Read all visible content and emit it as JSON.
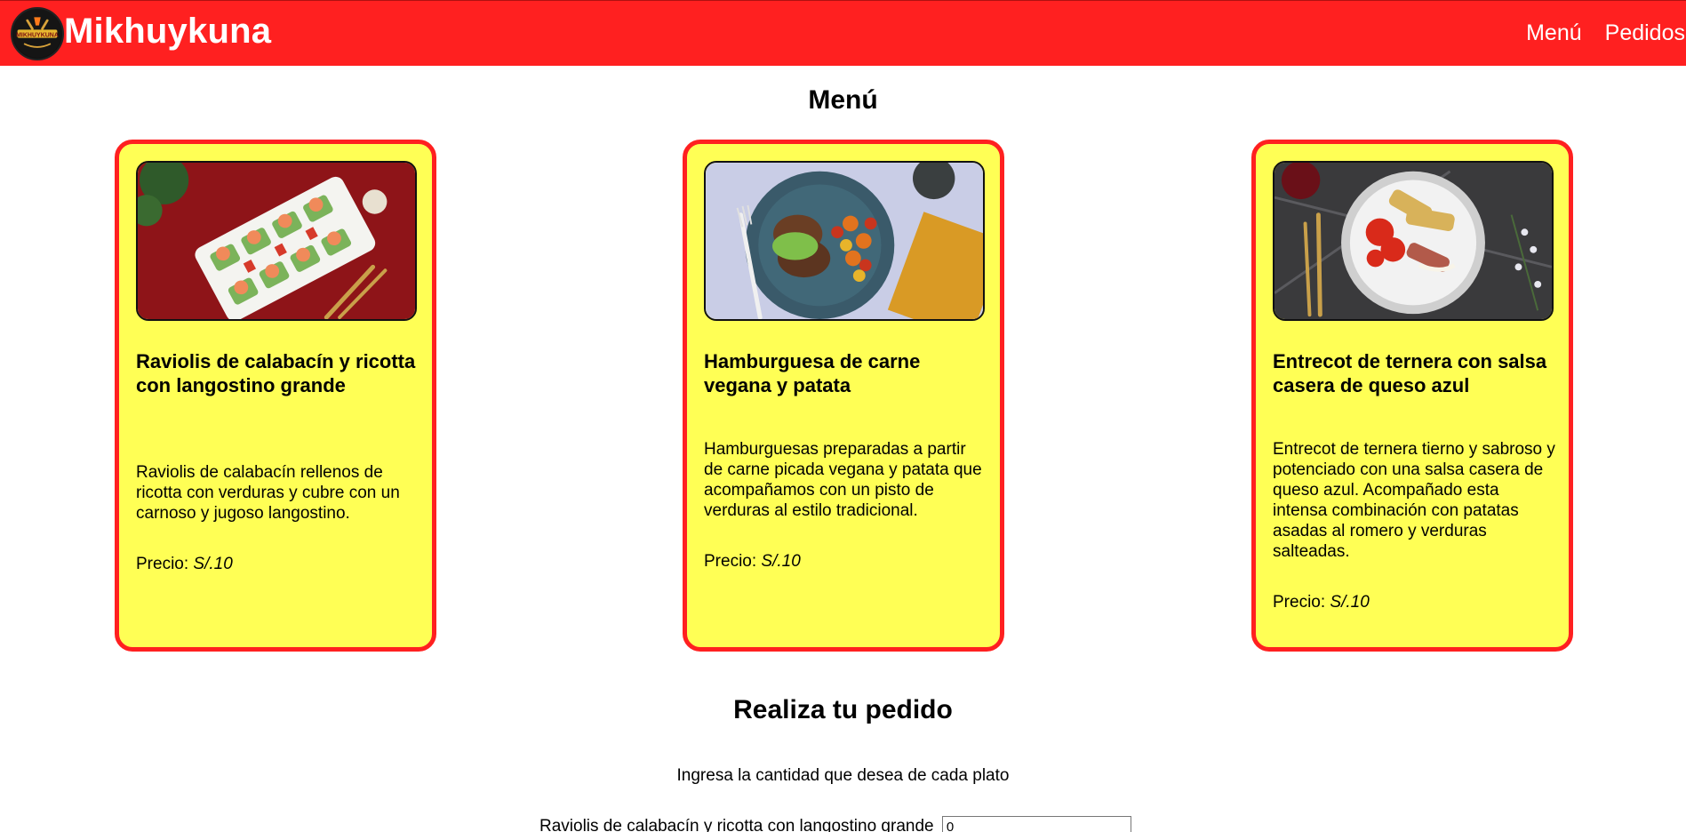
{
  "header": {
    "logo_text": "MIKHUYKUNA",
    "brand": "Mikhuykuna",
    "nav": [
      {
        "label": "Menú"
      },
      {
        "label": "Pedidos"
      }
    ],
    "color": "#ff2020"
  },
  "menu": {
    "title": "Menú",
    "price_label": "Precio:",
    "items": [
      {
        "name": "Raviolis de calabacín y ricotta con langostino grande",
        "description": "Raviolis de calabacín rellenos de ricotta con verduras y cubre con un carnoso y jugoso langostino.",
        "price": "S/.10",
        "image": "ravioli-plate-image"
      },
      {
        "name": "Hamburguesa de carne vegana y patata",
        "description": "Hamburguesas preparadas a partir de carne picada vegana y patata que acompañamos con un pisto de verduras al estilo tradicional.",
        "price": "S/.10",
        "image": "vegan-burger-plate-image"
      },
      {
        "name": "Entrecot de ternera con salsa casera de queso azul",
        "description": "Entrecot de ternera tierno y sabroso y potenciado con una salsa casera de queso azul. Acompañado esta intensa combinación con patatas asadas al romero y verduras salteadas.",
        "price": "S/.10",
        "image": "entrecot-plate-image"
      }
    ],
    "card_color": "#ffff55"
  },
  "order": {
    "title": "Realiza tu pedido",
    "intro": "Ingresa la cantidad que desea de cada plato",
    "rows": [
      {
        "label": "Raviolis de calabacín y ricotta con langostino grande",
        "value": "0"
      }
    ]
  }
}
